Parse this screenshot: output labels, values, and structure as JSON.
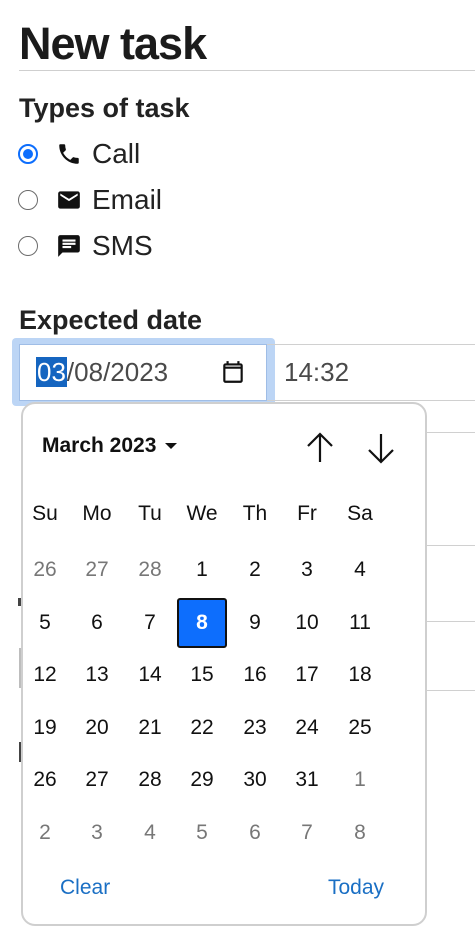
{
  "page": {
    "title": "New task"
  },
  "task_types": {
    "label": "Types of task",
    "options": [
      {
        "label": "Call",
        "icon": "phone-icon",
        "checked": true
      },
      {
        "label": "Email",
        "icon": "envelope-icon",
        "checked": false
      },
      {
        "label": "SMS",
        "icon": "message-icon",
        "checked": false
      }
    ]
  },
  "expected_date": {
    "label": "Expected date",
    "date_selected_segment": "03",
    "date_rest": "/08/2023",
    "time_value": "14:32",
    "calendar_icon": "calendar-icon"
  },
  "datepicker": {
    "month_label": "March 2023",
    "prev_icon": "arrow-up-icon",
    "next_icon": "arrow-down-icon",
    "weekdays": [
      "Su",
      "Mo",
      "Tu",
      "We",
      "Th",
      "Fr",
      "Sa"
    ],
    "weeks": [
      [
        "26",
        "27",
        "28",
        "1",
        "2",
        "3",
        "4"
      ],
      [
        "5",
        "6",
        "7",
        "8",
        "9",
        "10",
        "11"
      ],
      [
        "12",
        "13",
        "14",
        "15",
        "16",
        "17",
        "18"
      ],
      [
        "19",
        "20",
        "21",
        "22",
        "23",
        "24",
        "25"
      ],
      [
        "26",
        "27",
        "28",
        "29",
        "30",
        "31",
        "1"
      ],
      [
        "2",
        "3",
        "4",
        "5",
        "6",
        "7",
        "8"
      ]
    ],
    "selected_day": "8",
    "clear_label": "Clear",
    "today_label": "Today",
    "accent_color": "#0d6efd",
    "link_color": "#1a6fc4"
  }
}
